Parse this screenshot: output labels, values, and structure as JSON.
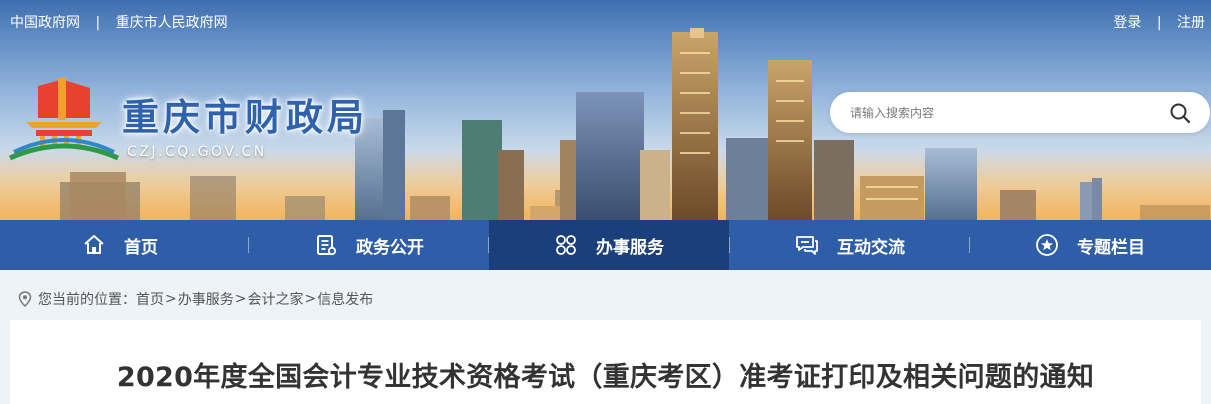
{
  "topbar": {
    "links_left": [
      "中国政府网",
      "重庆市人民政府网"
    ],
    "separator": "|",
    "login": "登录",
    "register": "注册"
  },
  "site": {
    "title": "重庆市财政局",
    "domain": "CZJ.CQ.GOV.CN"
  },
  "search": {
    "placeholder": "请输入搜索内容",
    "value": "",
    "icon": "search-icon"
  },
  "nav": {
    "items": [
      {
        "label": "首页",
        "icon": "home-icon",
        "active": false
      },
      {
        "label": "政务公开",
        "icon": "document-icon",
        "active": false
      },
      {
        "label": "办事服务",
        "icon": "grid-icon",
        "active": true
      },
      {
        "label": "互动交流",
        "icon": "chat-icon",
        "active": false
      },
      {
        "label": "专题栏目",
        "icon": "star-circle-icon",
        "active": false
      }
    ]
  },
  "breadcrumb": {
    "prefix": "您当前的位置：",
    "items": [
      "首页",
      "办事服务",
      "会计之家",
      "信息发布"
    ],
    "separator": ">"
  },
  "article": {
    "title": "2020年度全国会计专业技术资格考试（重庆考区）准考证打印及相关问题的通知"
  },
  "colors": {
    "nav_bg": "#2e5ea7",
    "nav_active_bg": "#1b3f7a",
    "title_blue": "#2f62ad",
    "page_bg": "#eef3f8"
  }
}
